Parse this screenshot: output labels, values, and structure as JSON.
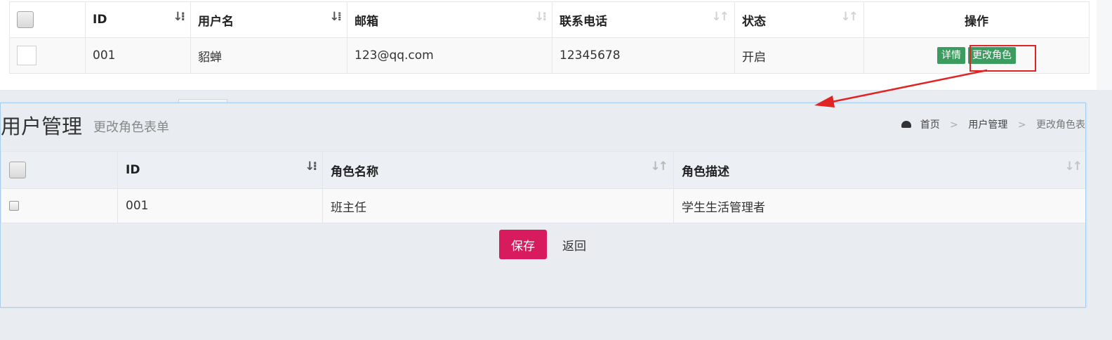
{
  "user_table": {
    "headers": {
      "id": "ID",
      "username": "用户名",
      "email": "邮箱",
      "phone": "联系电话",
      "status": "状态",
      "actions": "操作"
    },
    "row": {
      "id": "001",
      "username": "貂蝉",
      "email": "123@qq.com",
      "phone": "12345678",
      "status": "开启"
    },
    "actions": {
      "detail_label": "详情",
      "change_role_label": "更改角色"
    }
  },
  "role_form": {
    "title": "用户管理",
    "subtitle": "更改角色表单",
    "breadcrumb": [
      "首页",
      "用户管理",
      "更改角色表"
    ],
    "headers": {
      "id": "ID",
      "role_name": "角色名称",
      "role_desc": "角色描述"
    },
    "row": {
      "id": "001",
      "role_name": "班主任",
      "role_desc": "学生生活管理者"
    },
    "save_label": "保存",
    "back_label": "返回"
  },
  "icons": {
    "breadcrumb_home": "dashboard-icon",
    "sort": "sort-icon"
  },
  "colors": {
    "save_button": "#d71b5d",
    "action_button": "#3c9b5e",
    "highlight": "#e02323",
    "overlay_border": "#a9cdee"
  }
}
